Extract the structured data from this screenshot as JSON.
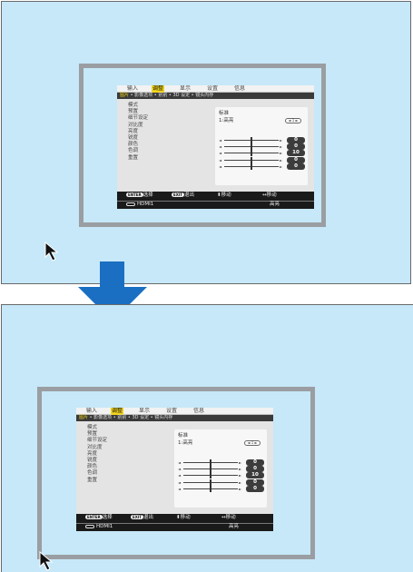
{
  "osd": {
    "tabs": [
      "输入",
      "调整",
      "显示",
      "设置",
      "信息"
    ],
    "active_tab": 1,
    "breadcrumb": {
      "current": "图片",
      "rest": [
        "影像选项",
        "别别",
        "3D 设定",
        "镜头内存"
      ]
    },
    "labels": [
      "模式",
      "预置",
      "细节设定",
      "对比度",
      "亮度",
      "锐度",
      "颜色",
      "色调",
      "重置"
    ],
    "mode_value": "标准",
    "preset_value": "1:高亮",
    "preset_control": "◄ 1 ►",
    "sliders": [
      {
        "name": "对比度",
        "value": "0",
        "level": 0.5
      },
      {
        "name": "亮度",
        "value": "0",
        "level": 0.5
      },
      {
        "name": "锐度",
        "value": "10",
        "level": 0.5
      },
      {
        "name": "颜色",
        "value": "0",
        "level": 0.5
      },
      {
        "name": "色调",
        "value": "0",
        "level": 0.5
      }
    ],
    "footer": {
      "enter_key": "ENTER",
      "enter_label": "选择",
      "exit_key": "EXIT",
      "exit_label": "退出",
      "move_label": "移动",
      "move_glyph": "⬍",
      "move2_label": "移动",
      "move2_glyph": "↔",
      "source": "HDMI1",
      "power_mode": "高亮"
    }
  },
  "colors": {
    "screen_bg": "#c6e8f8",
    "frame": "#9a9ea2",
    "arrow": "#1a6fc2",
    "tab_active": "#f1d31c"
  }
}
